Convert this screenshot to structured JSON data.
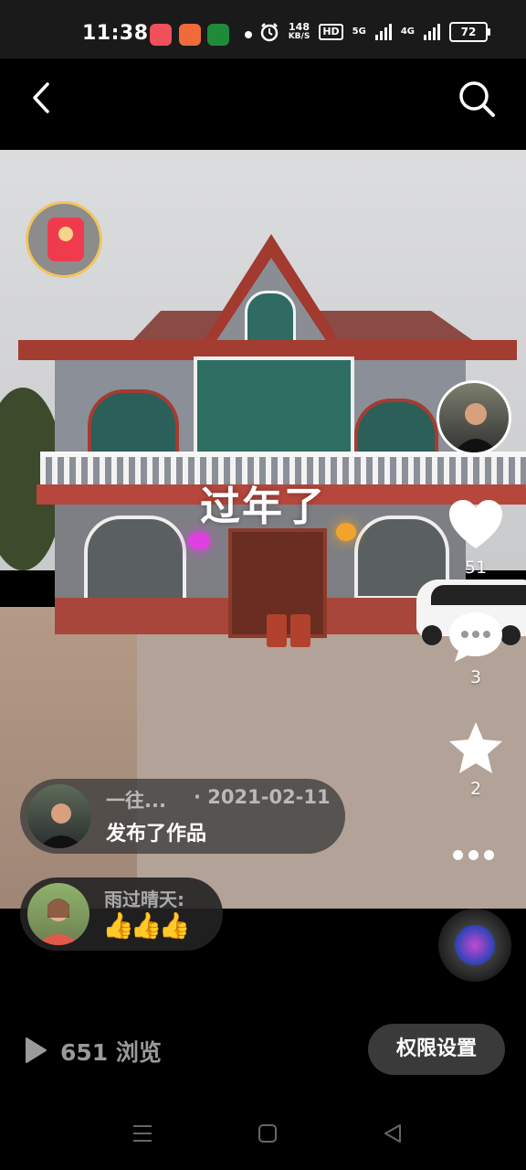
{
  "status_bar": {
    "time": "11:38",
    "net_speed_value": "148",
    "net_speed_unit": "KB/S",
    "hd_label": "HD",
    "network_5g": "5G",
    "network_4g": "4G",
    "battery": "72"
  },
  "header": {
    "back_icon": "back-arrow-icon",
    "search_icon": "search-icon"
  },
  "video": {
    "overlay_text": "过年了"
  },
  "sidebar": {
    "like_count": "51",
    "comment_count": "3",
    "favorite_count": "2"
  },
  "activity": [
    {
      "name": "一往...",
      "date": "· 2021-02-11",
      "text": "发布了作品"
    },
    {
      "name": "雨过晴天:",
      "text": "👍👍👍"
    }
  ],
  "footer": {
    "views": "651 浏览",
    "permission_button": "权限设置"
  },
  "colors": {
    "background": "#000000",
    "redpacket": "#f03b4e",
    "redpacket_ring": "#f3c45b"
  }
}
